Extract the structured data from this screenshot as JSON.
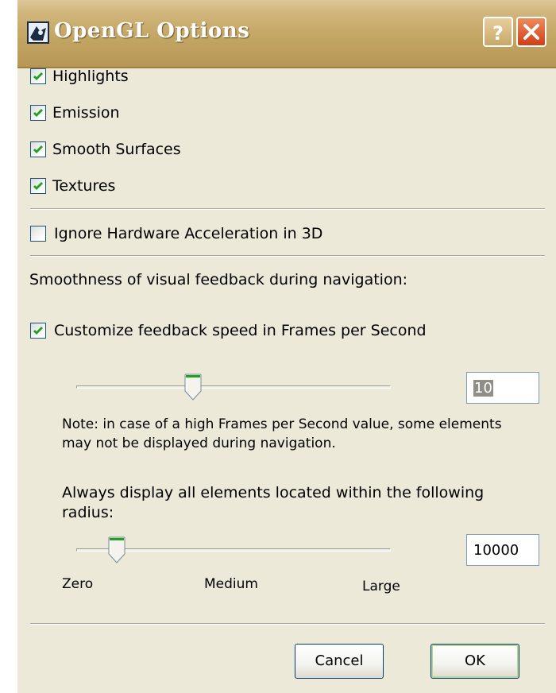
{
  "window": {
    "title": "OpenGL Options"
  },
  "checkboxes": {
    "highlights": {
      "label": "Highlights",
      "checked": true
    },
    "emission": {
      "label": "Emission",
      "checked": true
    },
    "smooth_surfaces": {
      "label": "Smooth Surfaces",
      "checked": true
    },
    "textures": {
      "label": "Textures",
      "checked": true
    },
    "ignore_hw_accel": {
      "label": "Ignore Hardware Acceleration in 3D",
      "checked": false
    },
    "customize_feedback": {
      "label": "Customize feedback speed in Frames per Second",
      "checked": true
    }
  },
  "smoothness_label": "Smoothness of visual feedback during navigation:",
  "fps": {
    "value": "10",
    "slider_fraction": 0.37,
    "note_line1": "Note: in case of a high Frames per Second value, some elements",
    "note_line2": "may not be displayed during navigation."
  },
  "radius": {
    "label_line1": "Always display all elements located within the following",
    "label_line2": "radius:",
    "value": "10000",
    "slider_fraction": 0.13,
    "scale": {
      "low": "Zero",
      "mid": "Medium",
      "high": "Large"
    }
  },
  "buttons": {
    "cancel": "Cancel",
    "ok": "OK"
  },
  "colors": {
    "titlebar": "#c2a462",
    "dialog": "#ece9d8",
    "check": "#21a121",
    "close": "#cf3e17"
  }
}
